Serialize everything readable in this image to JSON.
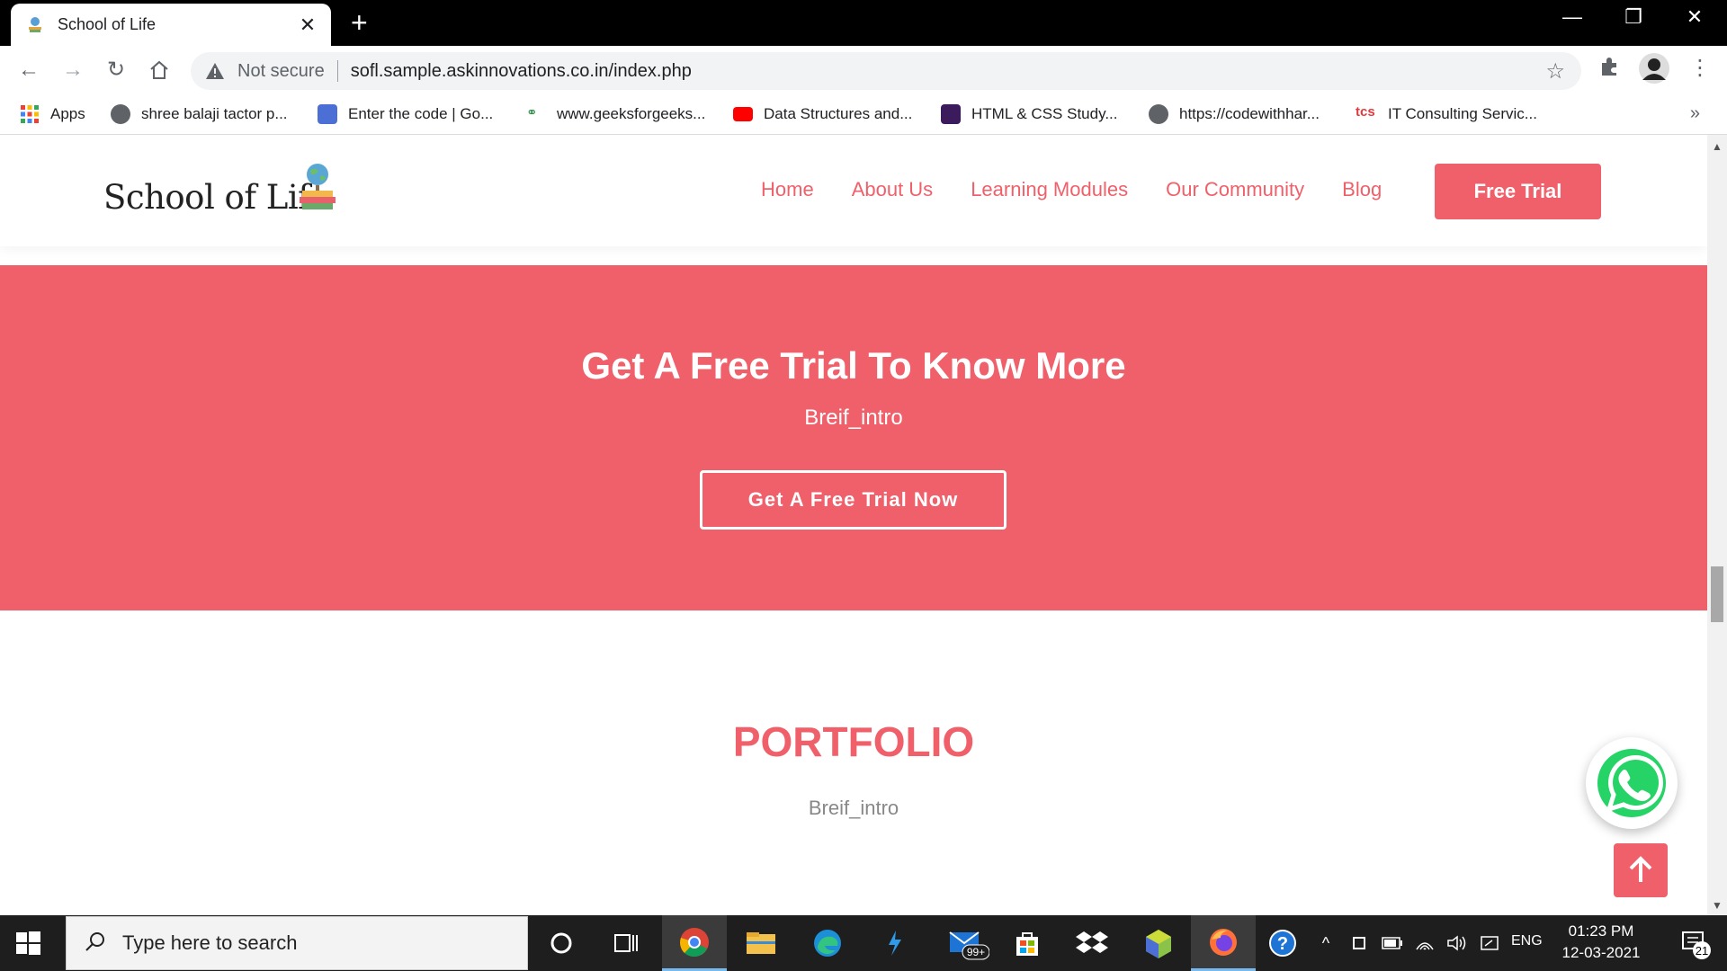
{
  "browser": {
    "tab_title": "School of Life",
    "new_tab": "+",
    "tab_close": "✕",
    "security_label": "Not secure",
    "url": "sofl.sample.askinnovations.co.in/index.php",
    "bookmarks": [
      {
        "label": "Apps",
        "icon": "apps-grid-icon"
      },
      {
        "label": "shree balaji tactor p...",
        "icon": "globe-icon"
      },
      {
        "label": "Enter the code | Go...",
        "icon": "classroom-icon"
      },
      {
        "label": "www.geeksforgeeks...",
        "icon": "geeksforgeeks-icon"
      },
      {
        "label": "Data Structures and...",
        "icon": "youtube-icon"
      },
      {
        "label": "HTML & CSS Study...",
        "icon": "pw-icon"
      },
      {
        "label": "https://codewithhar...",
        "icon": "globe-icon"
      },
      {
        "label": "IT Consulting Servic...",
        "icon": "tcs-icon"
      }
    ],
    "more": "»"
  },
  "site": {
    "logo": "School of Life",
    "nav": [
      "Home",
      "About Us",
      "Learning Modules",
      "Our Community",
      "Blog"
    ],
    "cta_button": "Free Trial"
  },
  "cta": {
    "title": "Get A Free Trial To Know More",
    "intro": "Breif_intro",
    "button": "Get A Free Trial Now"
  },
  "portfolio": {
    "title": "PORTFOLIO",
    "intro": "Breif_intro"
  },
  "taskbar": {
    "search_placeholder": "Type here to search",
    "mail_badge": "99+",
    "language": "ENG",
    "time": "01:23 PM",
    "date": "12-03-2021",
    "notifications": "21"
  },
  "colors": {
    "brand": "#f0606a",
    "taskbar": "#1e1e1e"
  }
}
